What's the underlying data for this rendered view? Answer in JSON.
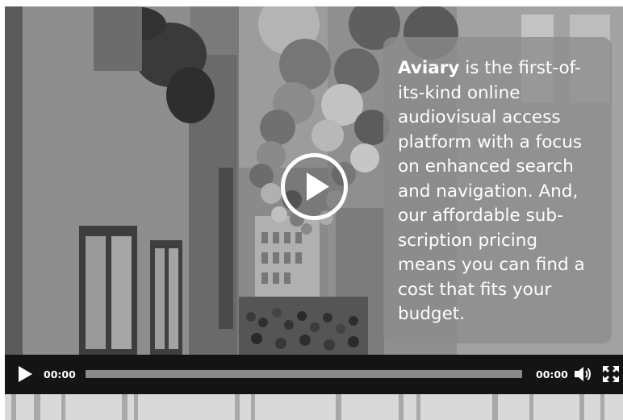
{
  "overlay": {
    "brand": "Aviary",
    "description": " is the first-of-its-kind online audiovisual access platform with a focus on enhanced search and navigation. And, our affordable sub-scription pricing means you can find a cost that fits your budget."
  },
  "player": {
    "current_time": "00:00",
    "duration": "00:00",
    "progress_percent": 0,
    "icons": {
      "play": "play-icon",
      "big_play": "play-circle-icon",
      "volume": "volume-icon",
      "fullscreen": "fullscreen-icon"
    }
  },
  "colors": {
    "controls_bg": "#141414",
    "panel_bg": "#8c8c8c",
    "text": "#ffffff",
    "track": "#8a8a8a"
  }
}
